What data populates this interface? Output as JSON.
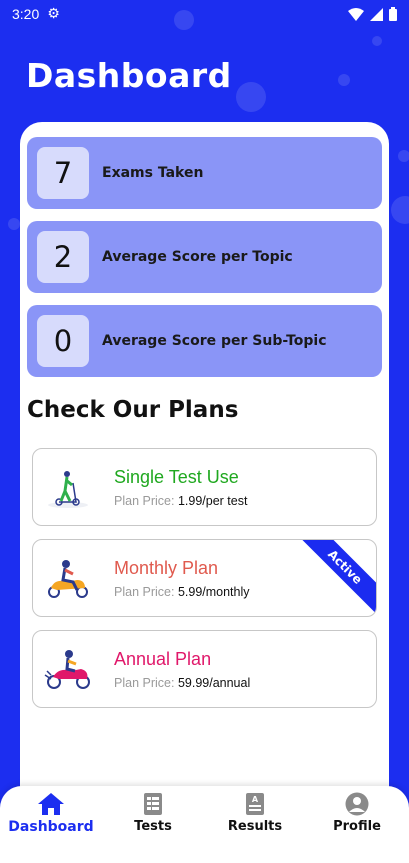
{
  "status_bar": {
    "time": "3:20"
  },
  "header": {
    "title": "Dashboard"
  },
  "stats": [
    {
      "value": "7",
      "label": "Exams Taken"
    },
    {
      "value": "2",
      "label": "Average Score per Topic"
    },
    {
      "value": "0",
      "label": "Average Score per Sub-Topic"
    }
  ],
  "plans_heading": "Check Our Plans",
  "plans": [
    {
      "name": "Single Test Use",
      "price_label": "Plan Price:",
      "price": "1.99/per test",
      "color": "#1fa81f",
      "icon": "scooter-icon"
    },
    {
      "name": "Monthly Plan",
      "price_label": "Plan Price:",
      "price": "5.99/monthly",
      "color": "#e05a4e",
      "icon": "moped-rider-icon",
      "badge": "Active"
    },
    {
      "name": "Annual Plan",
      "price_label": "Plan Price:",
      "price": "59.99/annual",
      "color": "#e0186a",
      "icon": "motorbike-rider-icon"
    }
  ],
  "nav": {
    "dashboard": "Dashboard",
    "tests": "Tests",
    "results": "Results",
    "profile": "Profile"
  },
  "colors": {
    "primary": "#1c2ef0",
    "stat_card": "#8a95f7",
    "stat_number_bg": "#d7dbfc"
  }
}
